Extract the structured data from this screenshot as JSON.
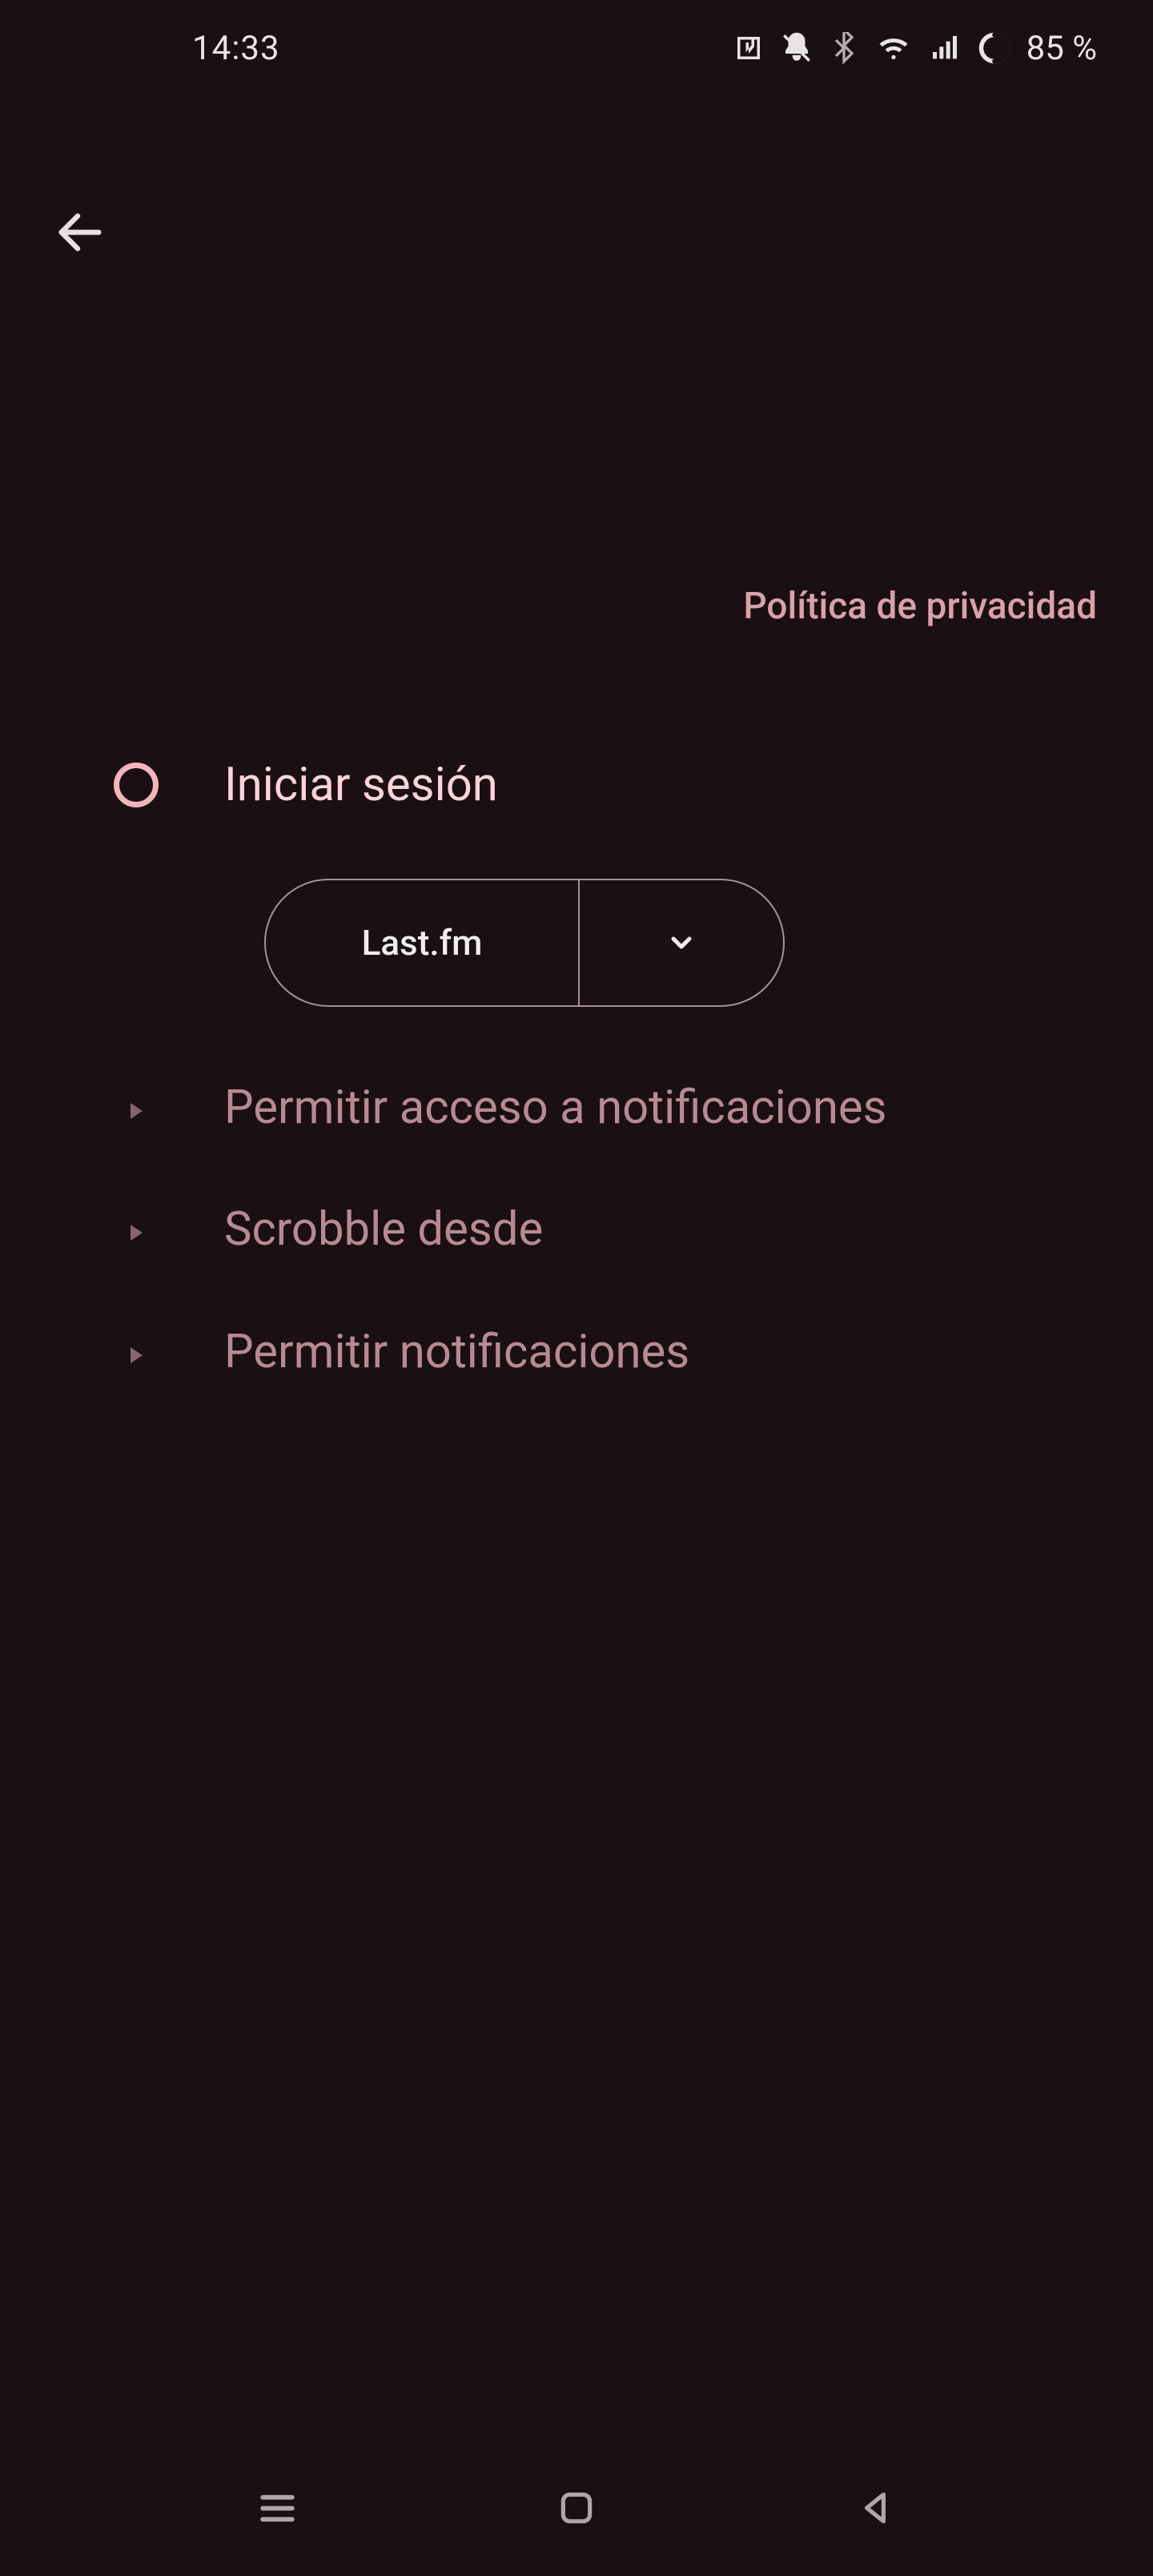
{
  "status_bar": {
    "time": "14:33",
    "battery_text": "85 %"
  },
  "privacy_link": "Política de privacidad",
  "steps": {
    "login": "Iniciar sesión",
    "notif_access": "Permitir acceso a notificaciones",
    "scrobble_from": "Scrobble desde",
    "allow_notif": "Permitir notificaciones"
  },
  "login_service": "Last.fm"
}
